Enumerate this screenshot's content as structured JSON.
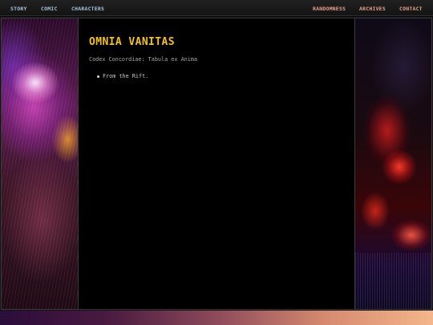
{
  "nav": {
    "left": [
      "STORY",
      "COMIC",
      "CHARACTERS"
    ],
    "right": [
      "RANDOMNESS",
      "ARCHIVES",
      "CONTACT"
    ]
  },
  "page": {
    "title": "OMNIA VANITAS",
    "subtitle": "Codex Concordiae: Tabula ex Anima",
    "items": [
      "From the Rift."
    ]
  },
  "colors": {
    "title": "#f2c21b",
    "nav_left": "#a8c3d8",
    "nav_right": "#e8a08b",
    "background": "#000000"
  }
}
